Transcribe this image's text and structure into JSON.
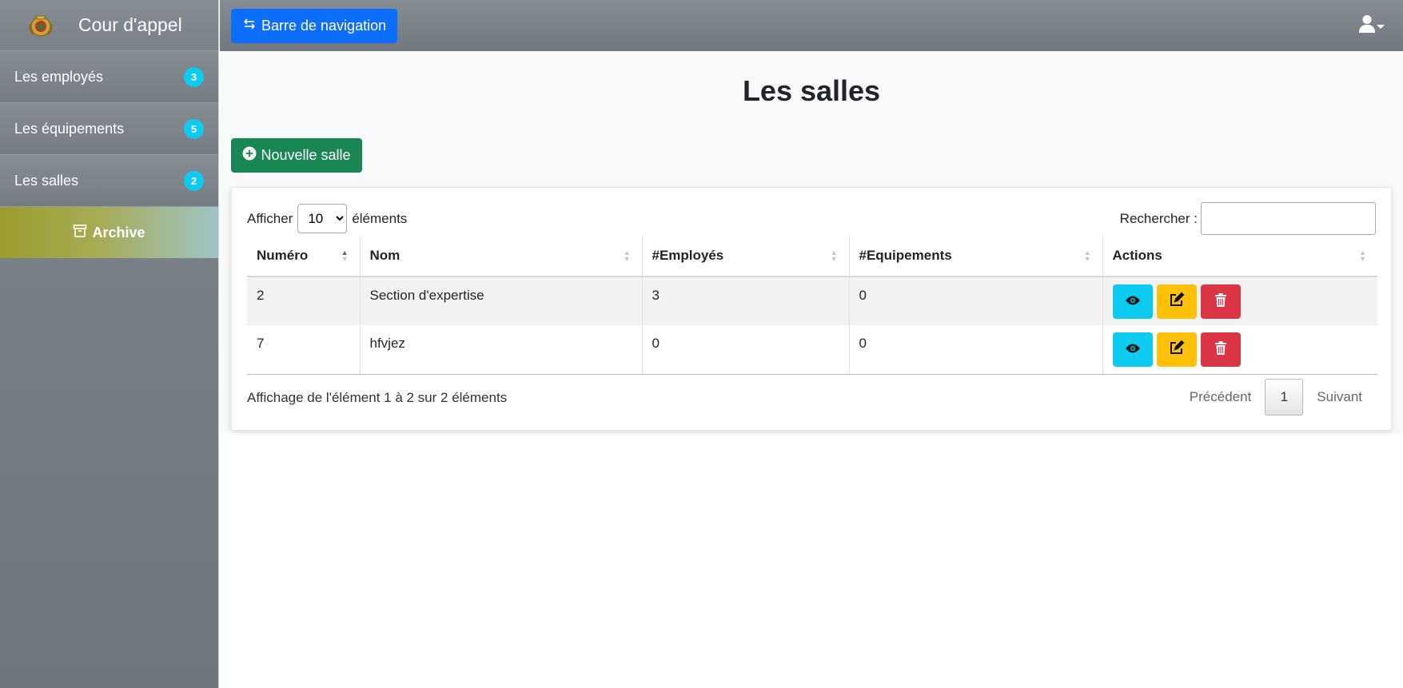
{
  "app": {
    "title": "Cour d'appel"
  },
  "sidebar": {
    "items": [
      {
        "label": "Les employés",
        "count": "3"
      },
      {
        "label": "Les équipements",
        "count": "5"
      },
      {
        "label": "Les salles",
        "count": "2"
      }
    ],
    "archive_label": "Archive"
  },
  "topbar": {
    "nav_button_label": "Barre de navigation",
    "user_icon": "user-icon"
  },
  "main": {
    "title": "Les salles",
    "new_button_label": "Nouvelle salle",
    "length_prefix": "Afficher",
    "length_value": "10",
    "length_suffix": "éléments",
    "search_label": "Rechercher :",
    "search_value": "",
    "table": {
      "headers": [
        "Numéro",
        "Nom",
        "#Employés",
        "#Equipements",
        "Actions"
      ],
      "rows": [
        [
          "2",
          "Section d'expertise",
          "3",
          "0"
        ],
        [
          "7",
          "hfvjez",
          "0",
          "0"
        ]
      ]
    },
    "info_text": "Affichage de l'élément 1 à 2 sur 2 éléments",
    "pagination": {
      "prev": "Précédent",
      "current": "1",
      "next": "Suivant"
    }
  },
  "colors": {
    "primary": "#0d6efd",
    "success": "#198754",
    "info": "#0dcaf0",
    "warning": "#ffc107",
    "danger": "#dc3545"
  }
}
